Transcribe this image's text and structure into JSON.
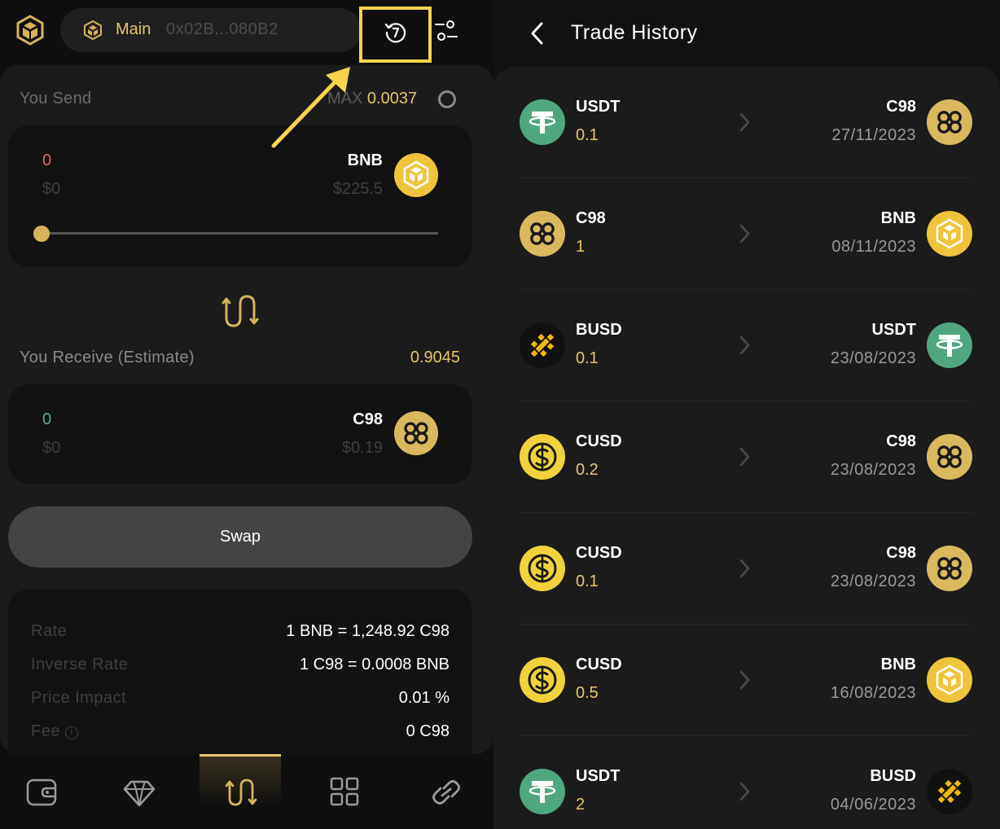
{
  "wallet": {
    "name": "Main",
    "address": "0x02B...080B2"
  },
  "swap": {
    "send_label": "You Send",
    "max_label": "MAX",
    "max_value": "0.0037",
    "send": {
      "amount": "0",
      "usd": "$0",
      "symbol": "BNB",
      "price": "$225.5",
      "slider_fraction": 0
    },
    "receive_label": "You Receive (Estimate)",
    "receive_estimate": "0.9045",
    "receive": {
      "amount": "0",
      "usd": "$0",
      "symbol": "C98",
      "price": "$0.19"
    },
    "swap_button": "Swap",
    "info": [
      {
        "key": "Rate",
        "value": "1 BNB = 1,248.92 C98"
      },
      {
        "key": "Inverse Rate",
        "value": "1 C98 = 0.0008 BNB"
      },
      {
        "key": "Price Impact",
        "value": "0.01 %"
      },
      {
        "key": "Fee",
        "value": "0 C98"
      }
    ]
  },
  "nav": {
    "items": [
      "wallet-icon",
      "diamond-icon",
      "swap-icon",
      "apps-grid-icon",
      "link-icon"
    ],
    "active": "swap-icon"
  },
  "history": {
    "title": "Trade History",
    "trades": [
      {
        "from": "USDT",
        "from_amount": "0.1",
        "to": "C98",
        "date": "27/11/2023"
      },
      {
        "from": "C98",
        "from_amount": "1",
        "to": "BNB",
        "date": "08/11/2023"
      },
      {
        "from": "BUSD",
        "from_amount": "0.1",
        "to": "USDT",
        "date": "23/08/2023"
      },
      {
        "from": "CUSD",
        "from_amount": "0.2",
        "to": "C98",
        "date": "23/08/2023"
      },
      {
        "from": "CUSD",
        "from_amount": "0.1",
        "to": "C98",
        "date": "23/08/2023"
      },
      {
        "from": "CUSD",
        "from_amount": "0.5",
        "to": "BNB",
        "date": "16/08/2023"
      },
      {
        "from": "USDT",
        "from_amount": "2",
        "to": "BUSD",
        "date": "04/06/2023"
      }
    ]
  },
  "colors": {
    "accent": "#e7c56a",
    "highlight": "#f6d44e",
    "usdt": "#4fa77f",
    "bnb": "#f0c33c",
    "c98": "#d9b95e",
    "busd": "#f0b90b"
  }
}
